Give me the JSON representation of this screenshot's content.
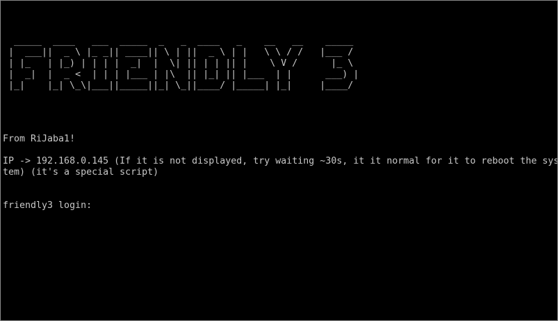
{
  "banner_lines": [
    " _____  ____   ___  _____  _   _  ____   _    __   __    _____ ",
    "|  ___||  _ \\ |_ _|| ____|| \\ | ||  _ \\ | |   \\ \\ / /   |___ / ",
    "| |_   | |_) | | | |  _|  |  \\| || | | || |    \\ V /      |_ \\ ",
    "|  _|  |  _ <  | | | |___ | |\\  || |_| || |___  | |      ___) |",
    "|_|    |_| \\_\\|___||_____||_| \\_||____/ |_____| |_|     |____/ "
  ],
  "greeting": "From RiJaba1!",
  "ip_line_1": "IP -> 192.168.0.145 (If it is not displayed, try waiting ~30s, it it normal for it to reboot the sys",
  "ip_line_2": "tem) (it's a special script)",
  "login_prompt": "friendly3 login: "
}
